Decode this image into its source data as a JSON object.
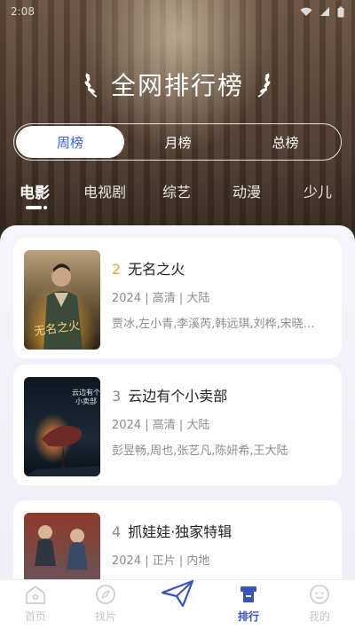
{
  "status_bar": {
    "time": "2:08"
  },
  "header": {
    "title": "全网排行榜"
  },
  "period_tabs": [
    {
      "label": "周榜",
      "active": true
    },
    {
      "label": "月榜",
      "active": false
    },
    {
      "label": "总榜",
      "active": false
    }
  ],
  "category_tabs": [
    {
      "label": "电影",
      "active": true
    },
    {
      "label": "电视剧",
      "active": false
    },
    {
      "label": "综艺",
      "active": false
    },
    {
      "label": "动漫",
      "active": false
    },
    {
      "label": "少儿",
      "active": false
    }
  ],
  "rank_list": [
    {
      "rank": "2",
      "title": "无名之火",
      "meta": "2024 | 高清 | 大陆",
      "cast": "贾冰,左小青,李溪芮,韩远琪,刘桦,宋晓…"
    },
    {
      "rank": "3",
      "title": "云边有个小卖部",
      "meta": "2024 | 高清 | 大陆",
      "cast": "彭昱畅,周也,张艺凡,陈妍希,王大陆"
    },
    {
      "rank": "4",
      "title": "抓娃娃·独家特辑",
      "meta": "2024 | 正片 | 内地",
      "cast": ""
    }
  ],
  "bottom_nav": [
    {
      "label": "首页",
      "icon": "home-icon",
      "active": false
    },
    {
      "label": "找片",
      "icon": "compass-icon",
      "active": false
    },
    {
      "label": "排行",
      "icon": "ranking-icon",
      "active": true
    },
    {
      "label": "我的",
      "icon": "profile-icon",
      "active": false
    }
  ],
  "colors": {
    "accent": "#3c63e0",
    "rank_top": "#f0a42a",
    "nav_active": "#3b52b8"
  }
}
